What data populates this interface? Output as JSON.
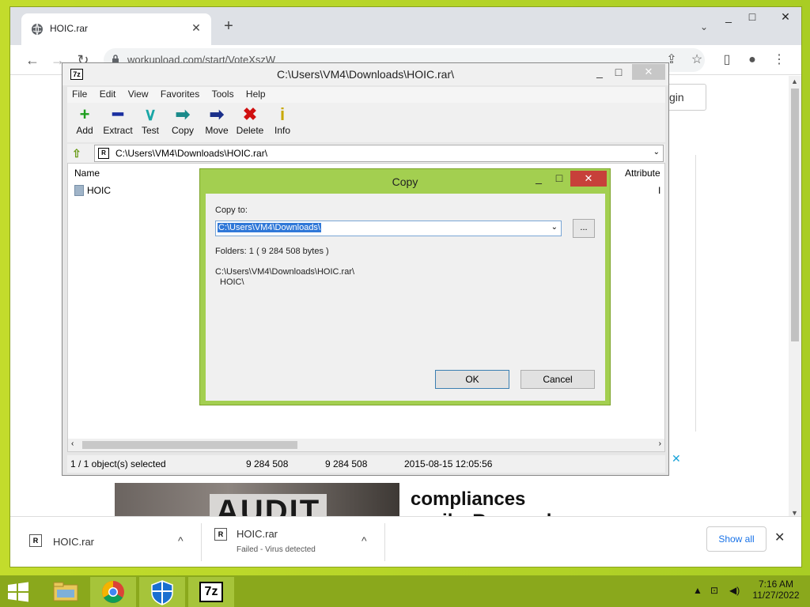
{
  "chrome": {
    "tab_title": "HOIC.rar",
    "tab_close": "✕",
    "new_tab": "+",
    "tab_menu": "⌄",
    "url": "workupload.com/start/VoteXszW",
    "back": "←",
    "forward": "→",
    "reload": "↻",
    "share_icon": "⇪",
    "star_icon": "☆",
    "sidebar_icon": "▯",
    "profile_icon": "●",
    "menu_icon": "⋮",
    "minimize": "_",
    "maximize": "□",
    "close": "✕"
  },
  "page": {
    "login_label": "gin",
    "ad_headline": "compliances",
    "ad_headline2": "easily. Research",
    "ad_image_text": "AUDIT",
    "ad_close": "✕"
  },
  "downloads": {
    "items": [
      {
        "name": "HOIC.rar",
        "status": ""
      },
      {
        "name": "HOIC.rar",
        "status": "Failed - Virus detected"
      }
    ],
    "show_all": "Show all",
    "close": "✕",
    "chevron": "^"
  },
  "sevenzip": {
    "title": "C:\\Users\\VM4\\Downloads\\HOIC.rar\\",
    "app_icon": "7z",
    "menu": [
      "File",
      "Edit",
      "View",
      "Favorites",
      "Tools",
      "Help"
    ],
    "toolbar": [
      {
        "label": "Add",
        "glyph": "+",
        "color": "#1e9e1e"
      },
      {
        "label": "Extract",
        "glyph": "━",
        "color": "#1a2fa0"
      },
      {
        "label": "Test",
        "glyph": "∨",
        "color": "#1aa6a6"
      },
      {
        "label": "Copy",
        "glyph": "➡",
        "color": "#1a8a8a"
      },
      {
        "label": "Move",
        "glyph": "➡",
        "color": "#1a2f8a"
      },
      {
        "label": "Delete",
        "glyph": "✖",
        "color": "#d01010"
      },
      {
        "label": "Info",
        "glyph": "i",
        "color": "#c8a800"
      }
    ],
    "address": "C:\\Users\\VM4\\Downloads\\HOIC.rar\\",
    "columns": {
      "name": "Name",
      "attributes": "Attribute"
    },
    "rows": [
      {
        "name": "HOIC",
        "attr": "I"
      }
    ],
    "status": {
      "selected": "1 / 1 object(s) selected",
      "size": "9 284 508",
      "packed": "9 284 508",
      "modified": "2015-08-15 12:05:56"
    },
    "minimize": "_",
    "maximize": "□",
    "close": "✕"
  },
  "copy_dialog": {
    "title": "Copy",
    "copy_to_label": "Copy to:",
    "copy_to_value": "C:\\Users\\VM4\\Downloads\\",
    "browse": "...",
    "info": "Folders: 1    ( 9 284 508 bytes )",
    "source_path": "C:\\Users\\VM4\\Downloads\\HOIC.rar\\",
    "source_item": "HOIC\\",
    "ok": "OK",
    "cancel": "Cancel",
    "minimize": "_",
    "maximize": "□",
    "close": "✕"
  },
  "taskbar": {
    "time": "7:16 AM",
    "date": "11/27/2022",
    "tray_up": "▲",
    "app_7z_label": "7z"
  },
  "colors": {
    "desktop": "#b8d42a",
    "dialog_frame": "#a3cf50",
    "close_red": "#c7403a",
    "link_blue": "#1a73e8"
  }
}
